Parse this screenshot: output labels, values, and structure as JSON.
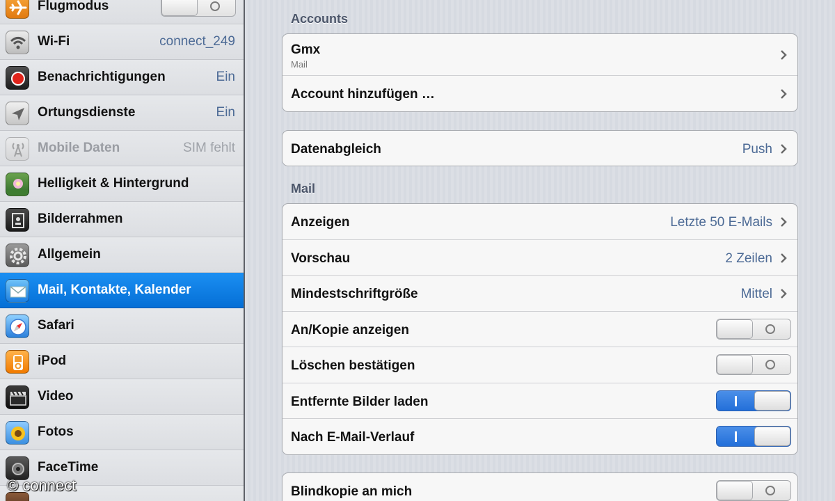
{
  "sidebar": {
    "items": [
      {
        "label": "Flugmodus",
        "value": "",
        "toggle": "off"
      },
      {
        "label": "Wi-Fi",
        "value": "connect_249"
      },
      {
        "label": "Benachrichtigungen",
        "value": "Ein"
      },
      {
        "label": "Ortungsdienste",
        "value": "Ein"
      },
      {
        "label": "Mobile Daten",
        "value": "SIM fehlt"
      },
      {
        "label": "Helligkeit & Hintergrund",
        "value": ""
      },
      {
        "label": "Bilderrahmen",
        "value": ""
      },
      {
        "label": "Allgemein",
        "value": ""
      },
      {
        "label": "Mail, Kontakte, Kalender",
        "value": ""
      },
      {
        "label": "Safari",
        "value": ""
      },
      {
        "label": "iPod",
        "value": ""
      },
      {
        "label": "Video",
        "value": ""
      },
      {
        "label": "Fotos",
        "value": ""
      },
      {
        "label": "FaceTime",
        "value": ""
      }
    ]
  },
  "main": {
    "accounts_header": "Accounts",
    "accounts": [
      {
        "label": "Gmx",
        "sublabel": "Mail"
      },
      {
        "label": "Account hinzufügen …"
      }
    ],
    "fetch": {
      "label": "Datenabgleich",
      "value": "Push"
    },
    "mail_header": "Mail",
    "mail_rows": [
      {
        "label": "Anzeigen",
        "value": "Letzte 50 E-Mails"
      },
      {
        "label": "Vorschau",
        "value": "2 Zeilen"
      },
      {
        "label": "Mindestschriftgröße",
        "value": "Mittel"
      },
      {
        "label": "An/Kopie anzeigen",
        "toggle": "off"
      },
      {
        "label": "Löschen bestätigen",
        "toggle": "off"
      },
      {
        "label": "Entfernte Bilder laden",
        "toggle": "on"
      },
      {
        "label": "Nach E-Mail-Verlauf",
        "toggle": "on"
      }
    ],
    "bcc": {
      "label": "Blindkopie an mich",
      "toggle": "off"
    }
  },
  "watermark": "© connect",
  "colors": {
    "selected_row": "#1b8ff2",
    "value_text": "#4c6a95",
    "switch_on": "#2f7ae0"
  }
}
